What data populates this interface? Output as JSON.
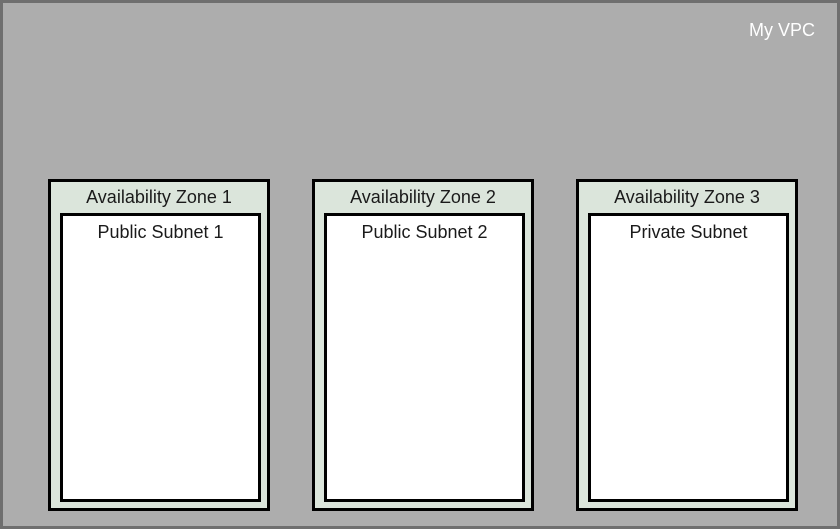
{
  "vpc": {
    "label": "My VPC"
  },
  "zones": [
    {
      "title": "Availability Zone 1",
      "subnet": {
        "title": "Public Subnet 1"
      }
    },
    {
      "title": "Availability Zone 2",
      "subnet": {
        "title": "Public Subnet 2"
      }
    },
    {
      "title": "Availability Zone 3",
      "subnet": {
        "title": "Private Subnet"
      }
    }
  ]
}
